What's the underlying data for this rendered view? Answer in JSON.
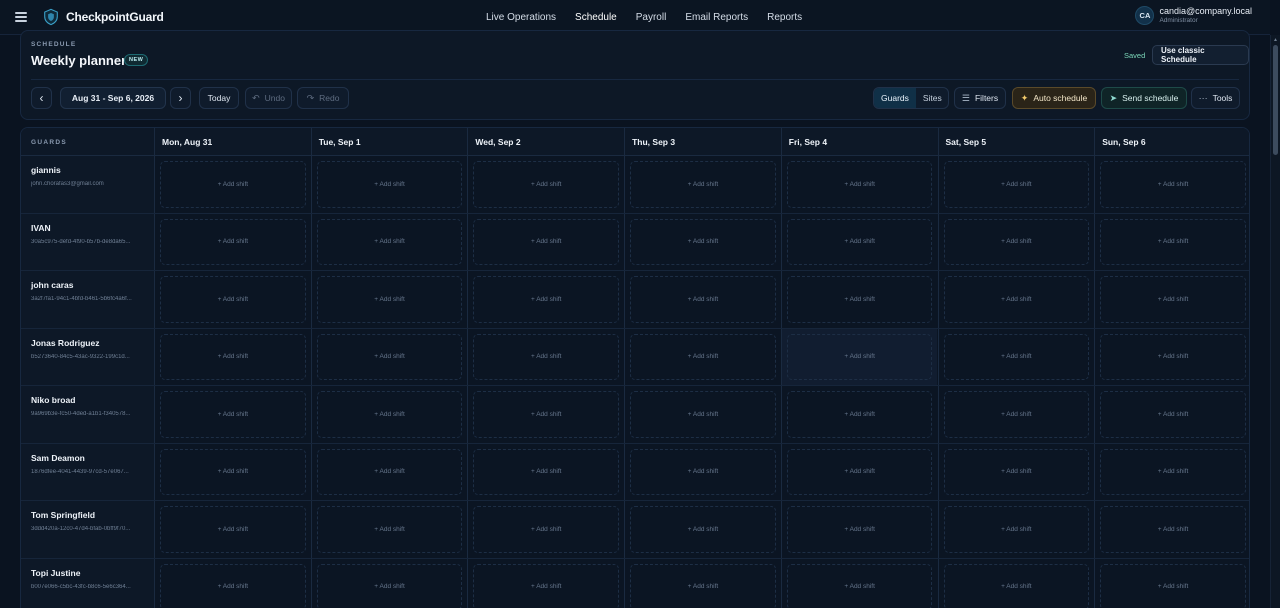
{
  "app": {
    "name": "CheckpointGuard"
  },
  "nav": {
    "items": [
      {
        "label": "Live Operations",
        "active": false
      },
      {
        "label": "Schedule",
        "active": true
      },
      {
        "label": "Payroll",
        "active": false
      },
      {
        "label": "Email Reports",
        "active": false
      },
      {
        "label": "Reports",
        "active": false
      }
    ]
  },
  "user": {
    "initials": "CA",
    "email": "candia@company.local",
    "role": "Administrator"
  },
  "planner": {
    "eyebrow": "SCHEDULE",
    "title": "Weekly planner",
    "badge": "NEW",
    "status": "Saved",
    "classic_label": "Use classic Schedule"
  },
  "toolbar": {
    "prev_icon": "‹",
    "next_icon": "›",
    "date_range": "Aug 31 - Sep 6, 2026",
    "today_label": "Today",
    "undo_label": "Undo",
    "redo_label": "Redo",
    "view_guards": "Guards",
    "view_sites": "Sites",
    "filters_label": "Filters",
    "auto_label": "Auto schedule",
    "send_label": "Send schedule",
    "tools_label": "Tools",
    "accent_color": "#f0c86a"
  },
  "grid": {
    "guards_header": "GUARDS",
    "add_shift_label": "+ Add shift",
    "days": [
      "Mon, Aug 31",
      "Tue, Sep 1",
      "Wed, Sep 2",
      "Thu, Sep 3",
      "Fri, Sep 4",
      "Sat, Sep 5",
      "Sun, Sep 6"
    ],
    "guards": [
      {
        "name": "giannis",
        "sub": "john.chorafas3@gmail.com"
      },
      {
        "name": "IVAN",
        "sub": "30a5c975-defd-4f90-b57b-de8da65..."
      },
      {
        "name": "john caras",
        "sub": "3a2f7fa1-94c1-4bfd-b461-5b6fc4a6f..."
      },
      {
        "name": "Jonas Rodriguez",
        "sub": "b5273640-84c5-43ac-9322-199c1d..."
      },
      {
        "name": "Niko broad",
        "sub": "9a969b3e-fc50-4ded-a1b1-f340578..."
      },
      {
        "name": "Sam Deamon",
        "sub": "1876dfee-4041-4439-97cd-57e067..."
      },
      {
        "name": "Tom Springfield",
        "sub": "3ddd420a-12c0-47d4-bfab-0bff9f70..."
      },
      {
        "name": "Topi Justine",
        "sub": "b007e066-c5bc-43fc-b8c6-5e6c364..."
      }
    ]
  }
}
